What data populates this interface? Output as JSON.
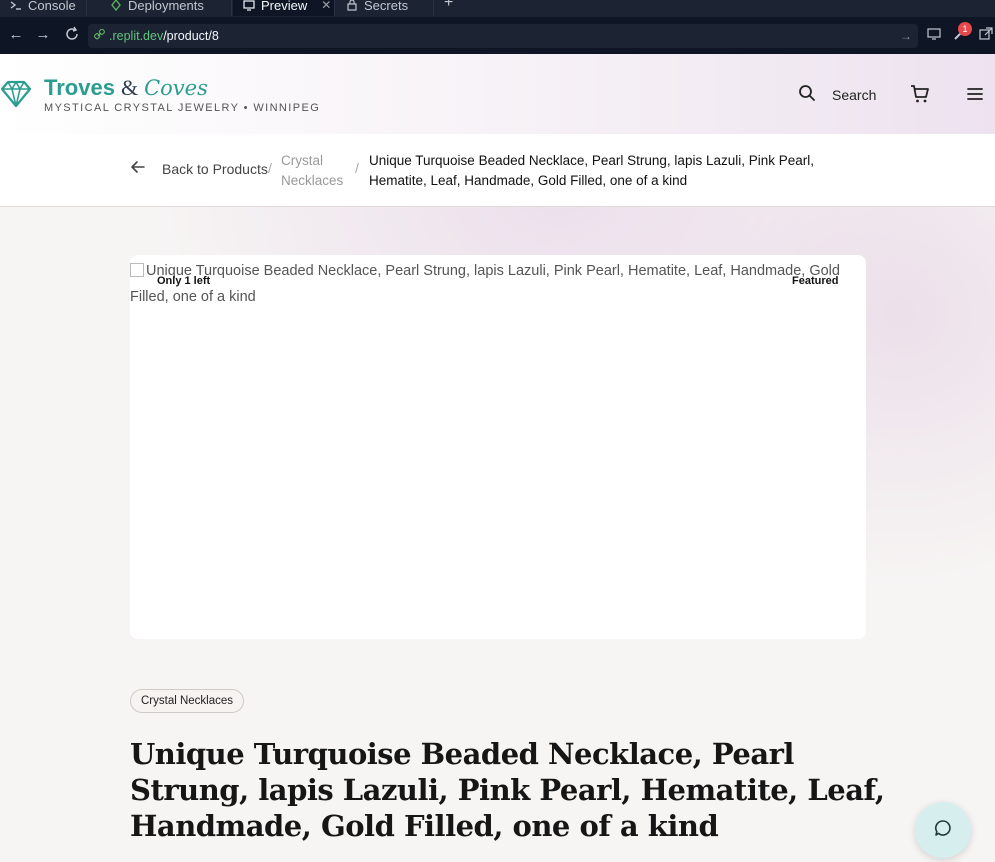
{
  "browser": {
    "tabs": [
      {
        "label": "Console",
        "icon": "terminal-icon"
      },
      {
        "label": "Deployments",
        "icon": "deploy-icon"
      },
      {
        "label": "Preview",
        "icon": "monitor-icon",
        "active": true
      },
      {
        "label": "Secrets",
        "icon": "lock-icon"
      }
    ],
    "url_domain": ".replit.dev",
    "url_path": "/product/8",
    "notification_count": "1"
  },
  "header": {
    "brand_main": "Troves",
    "brand_amp": "&",
    "brand_script": "Coves",
    "tagline": "MYSTICAL CRYSTAL JEWELRY • WINNIPEG",
    "search_label": "Search"
  },
  "breadcrumb": {
    "back_label": "Back to Products",
    "separator": "/",
    "category": "Crystal Necklaces",
    "current": "Unique Turquoise Beaded Necklace, Pearl Strung, lapis Lazuli, Pink Pearl, Hematite, Leaf, Handmade, Gold Filled, one of a kind"
  },
  "product": {
    "image_alt": "Unique Turquoise Beaded Necklace, Pearl Strung, lapis Lazuli, Pink Pearl, Hematite, Leaf, Handmade, Gold Filled, one of a kind",
    "stock_label": "Only 1 left",
    "featured_label": "Featured",
    "category_pill": "Crystal Necklaces",
    "title": "Unique Turquoise Beaded Necklace, Pearl Strung, lapis Lazuli, Pink Pearl, Hematite, Leaf, Handmade, Gold Filled, one of a kind"
  },
  "colors": {
    "brand_teal": "#2a9d8f",
    "chrome_bg": "#0e1525",
    "chat_bg": "#d6efee"
  }
}
